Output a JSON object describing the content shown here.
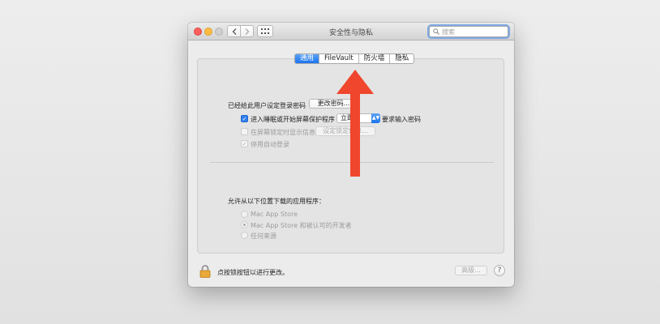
{
  "window": {
    "title": "安全性与隐私"
  },
  "search": {
    "placeholder": "搜索",
    "icon": "magnifier-icon"
  },
  "tabs": [
    {
      "label": "通用",
      "active": true
    },
    {
      "label": "FileVault",
      "active": false
    },
    {
      "label": "防火墙",
      "active": false
    },
    {
      "label": "隐私",
      "active": false
    }
  ],
  "general": {
    "login_password_label": "已经给此用户设定登录密码",
    "change_password_button": "更改密码...",
    "require_password_label": "进入睡眠或开始屏幕保护程序",
    "require_password_checked": true,
    "delay_value": "立即",
    "require_password_suffix": "要求输入密码",
    "show_message_label": "在屏幕锁定时显示信息",
    "show_message_checked": false,
    "set_lock_message_button": "设定锁定信息...",
    "disable_autologin_label": "停用自动登录",
    "disable_autologin_checked": true
  },
  "downloads": {
    "heading": "允许从以下位置下载的应用程序：",
    "options": [
      {
        "label": "Mac App Store",
        "selected": false
      },
      {
        "label": "Mac App Store 和被认可的开发者",
        "selected": true
      },
      {
        "label": "任何来源",
        "selected": false
      }
    ]
  },
  "footer": {
    "lock_text": "点按锁按钮以进行更改。",
    "advanced_button": "高级...",
    "help_label": "?"
  },
  "colors": {
    "accent": "#1c74ee",
    "annotation_arrow": "#f0462d"
  }
}
